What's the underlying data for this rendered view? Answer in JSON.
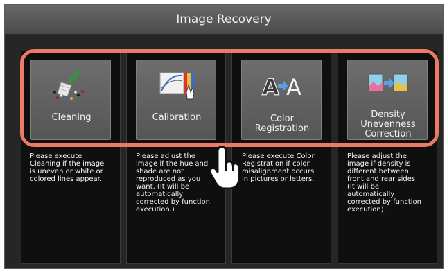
{
  "window": {
    "title": "Image Recovery"
  },
  "buttons": [
    {
      "label": "Cleaning",
      "icon": "broom-icon",
      "description": "Please execute\nCleaning if the image\nis uneven or white or\ncolored lines appear."
    },
    {
      "label": "Calibration",
      "icon": "calibration-icon",
      "description": "Please adjust the\nimage if the hue and\nshade are not\nreproduced as you\nwant. (It will be\nautomatically\ncorrected by function\nexecution.)"
    },
    {
      "label": "Color\nRegistration",
      "icon": "color-registration-icon",
      "description": "Please execute Color\nRegistration if color\nmisalignment occurs\nin pictures or letters."
    },
    {
      "label": "Density\nUnevenness\nCorrection",
      "icon": "density-correction-icon",
      "description": "Please adjust the\nimage if density is\ndifferent between\nfront and rear sides\n(It will be\nautomatically\ncorrected by function\nexecution)."
    }
  ],
  "icon_text": {
    "color_reg_glyph": "A"
  },
  "colors": {
    "highlight": "#ec7a67",
    "panel": "#262626",
    "column": "#0f0f0f",
    "button": "#606060"
  }
}
